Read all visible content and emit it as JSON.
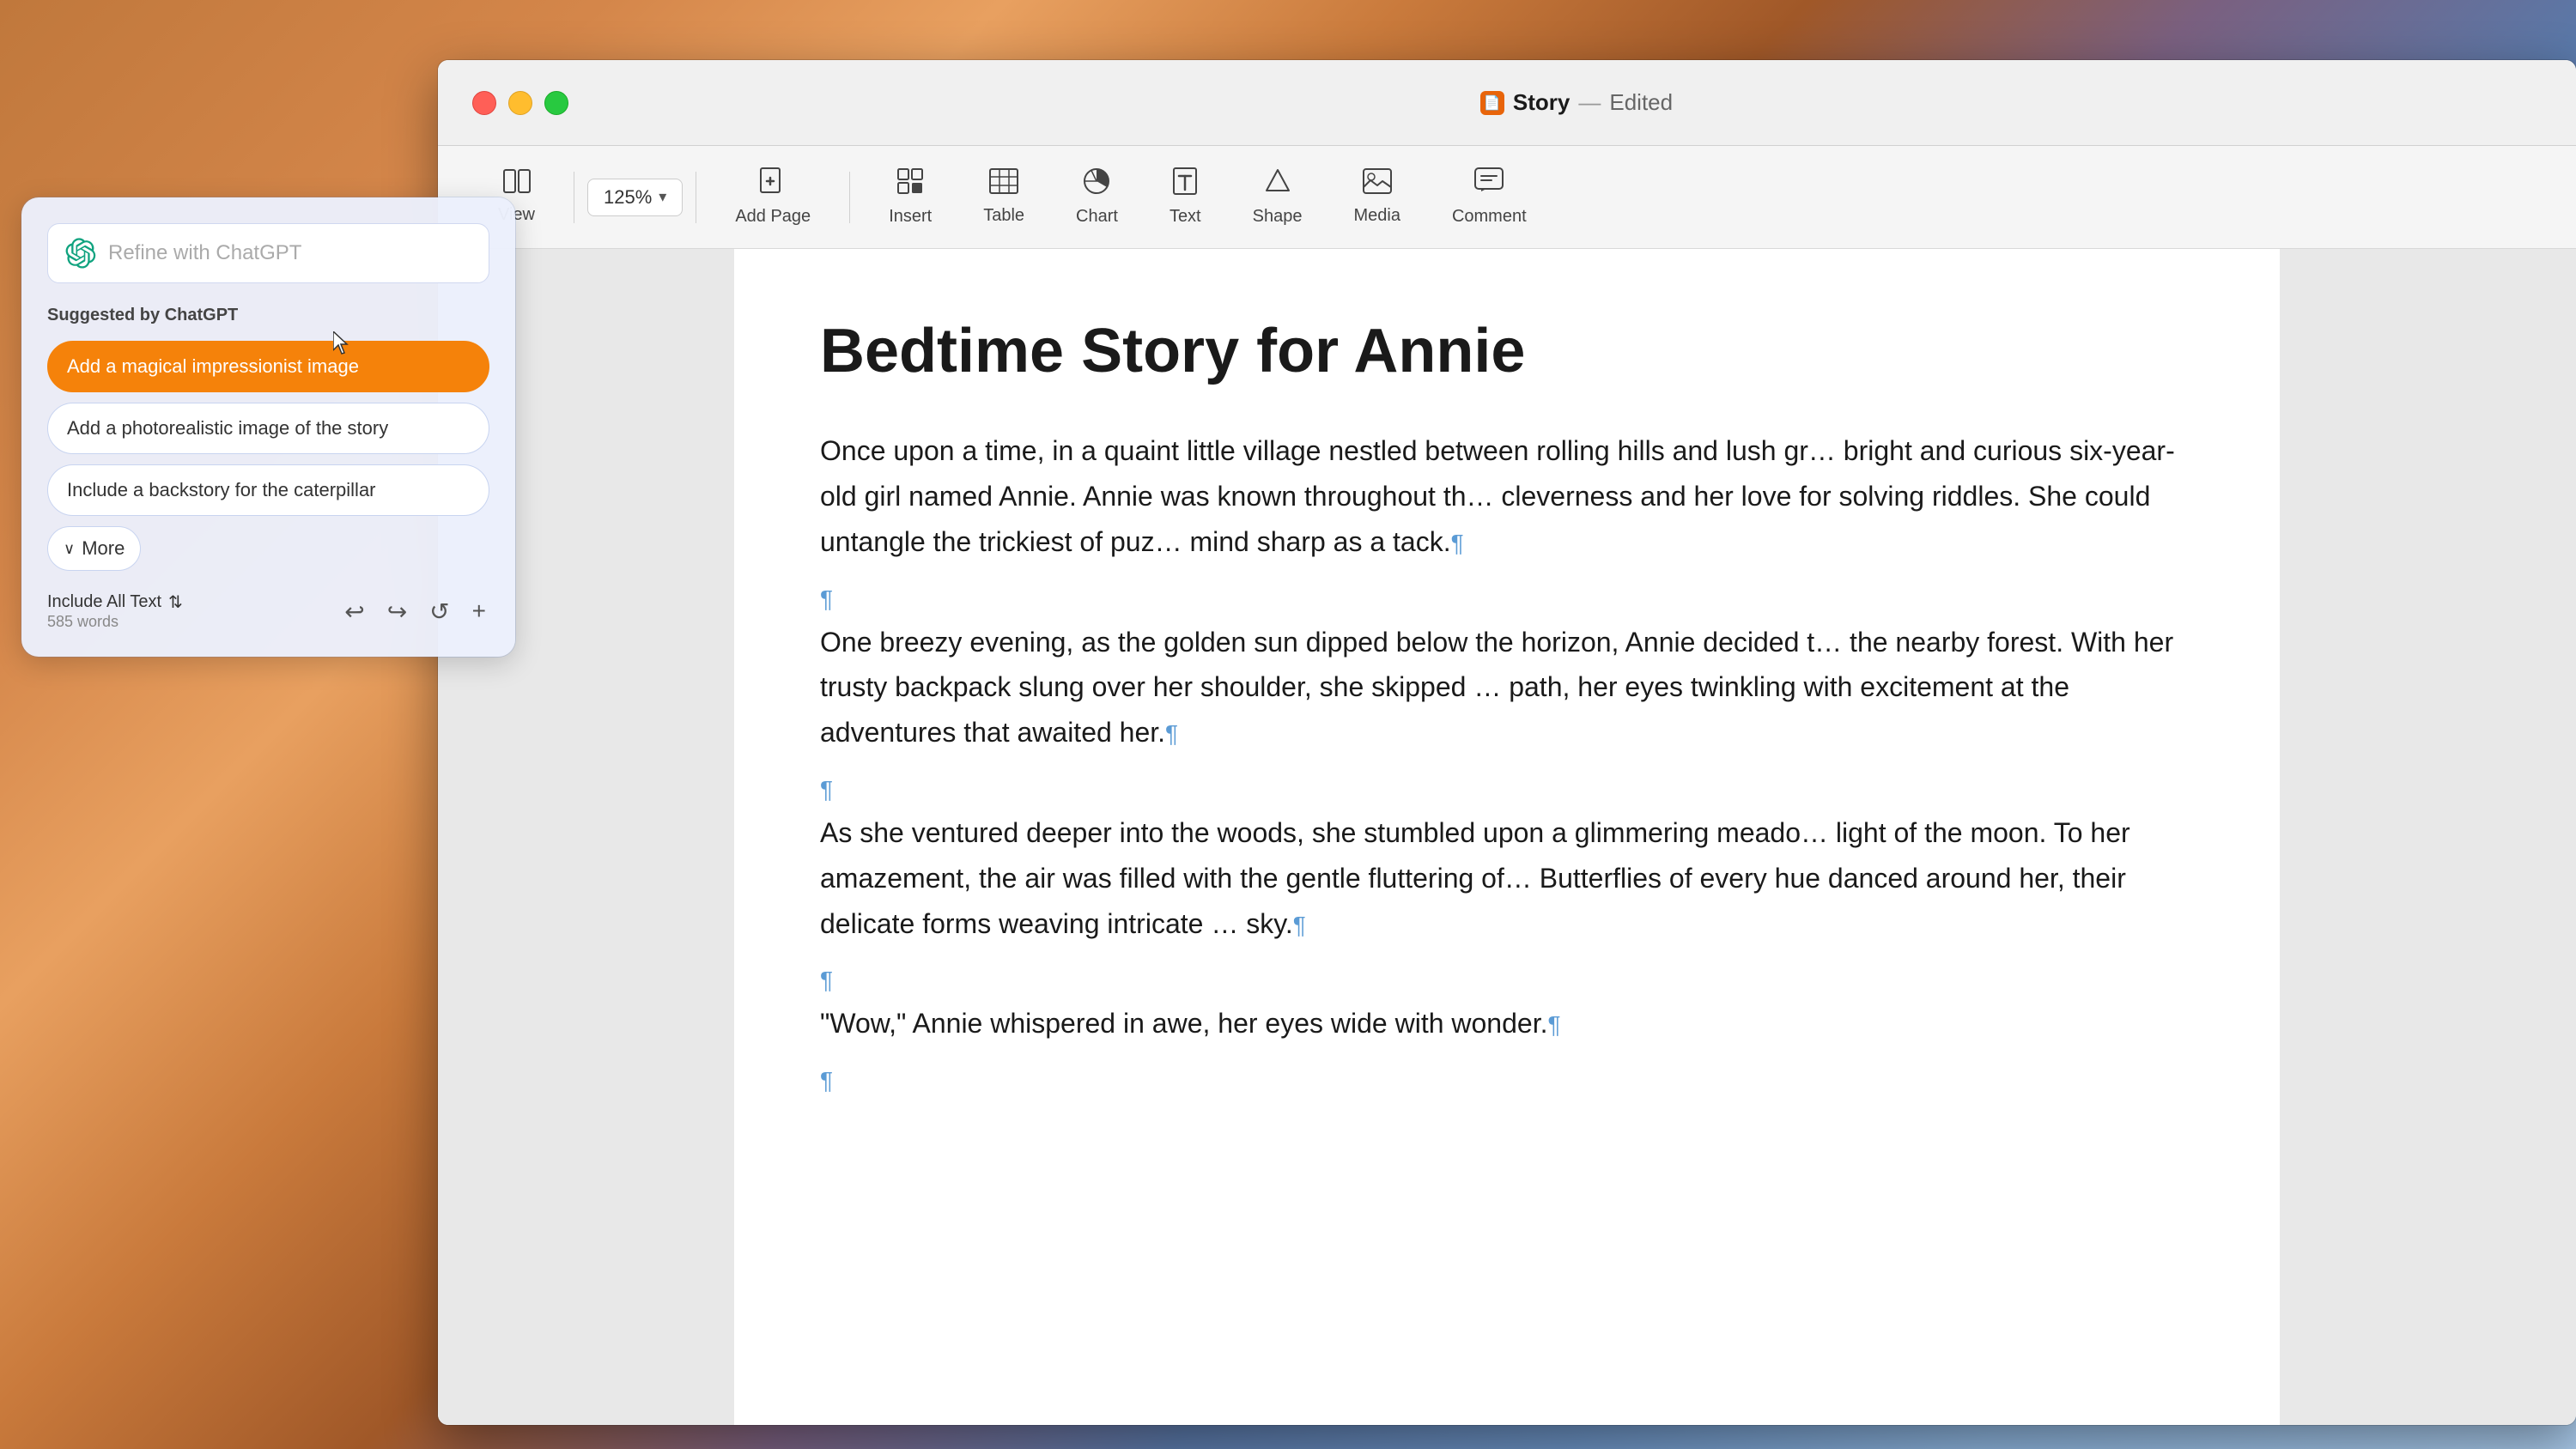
{
  "desktop": {
    "bg": "macOS desktop background"
  },
  "window": {
    "title": "Story",
    "separator": "—",
    "edited": "Edited",
    "titleIcon": "📝"
  },
  "trafficLights": {
    "close": "close",
    "minimize": "minimize",
    "maximize": "maximize"
  },
  "toolbar": {
    "zoom": "125%",
    "zoomArrow": "▾",
    "items": [
      {
        "id": "view",
        "icon": "⊞",
        "label": "View"
      },
      {
        "id": "zoom",
        "icon": "",
        "label": ""
      },
      {
        "id": "add-page",
        "icon": "+",
        "label": "Add Page"
      },
      {
        "id": "insert",
        "icon": "≡",
        "label": "Insert"
      },
      {
        "id": "table",
        "icon": "⊞",
        "label": "Table"
      },
      {
        "id": "chart",
        "icon": "◷",
        "label": "Chart"
      },
      {
        "id": "text",
        "icon": "T",
        "label": "Text"
      },
      {
        "id": "shape",
        "icon": "△",
        "label": "Shape"
      },
      {
        "id": "media",
        "icon": "🖼",
        "label": "Media"
      },
      {
        "id": "comment",
        "icon": "💬",
        "label": "Comment"
      }
    ]
  },
  "document": {
    "title": "Bedtime Story for Annie",
    "paragraphs": [
      "Once upon a time, in a quaint little village nestled between rolling hills and lush gr… bright and curious six-year-old girl named Annie. Annie was known throughout th… cleverness and her love for solving riddles. She could untangle the trickiest of puz… mind sharp as a tack.",
      "One breezy evening, as the golden sun dipped below the horizon, Annie decided t… the nearby forest. With her trusty backpack slung over her shoulder, she skipped … path, her eyes twinkling with excitement at the adventures that awaited her.",
      "As she ventured deeper into the woods, she stumbled upon a glimmering meado… light of the moon. To her amazement, the air was filled with the gentle fluttering of… Butterflies of every hue danced around her, their delicate forms weaving intricate … sky.",
      "\"Wow,\" Annie whispered in awe, her eyes wide with wonder."
    ]
  },
  "chatgptPanel": {
    "inputPlaceholder": "Refine with ChatGPT",
    "suggestedLabel": "Suggested by ChatGPT",
    "suggestions": [
      {
        "id": "magical-image",
        "text": "Add a magical impressionist image",
        "active": true
      },
      {
        "id": "photorealistic-image",
        "text": "Add a photorealistic image of the story",
        "active": false
      },
      {
        "id": "backstory-caterpillar",
        "text": "Include a backstory for the caterpillar",
        "active": false
      }
    ],
    "moreLabel": "More",
    "footerLeft": "Include All Text",
    "footerLeftIcon": "⇅",
    "wordCount": "585 words",
    "actions": {
      "undo": "↩",
      "redo": "↪",
      "refresh": "↺",
      "add": "+"
    }
  }
}
